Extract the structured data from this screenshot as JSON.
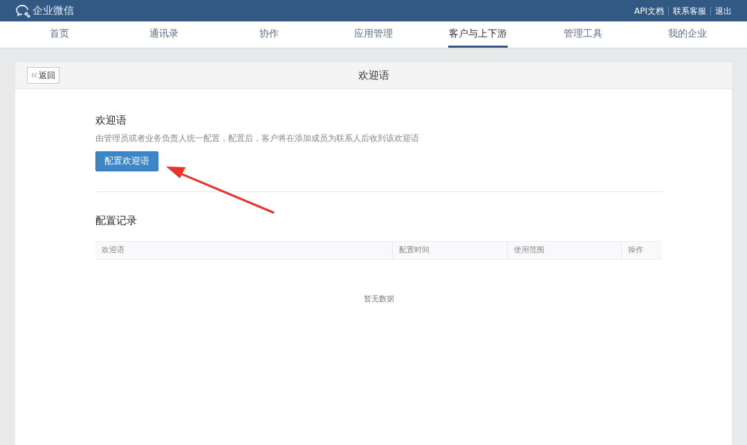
{
  "header": {
    "logo": "企业微信",
    "links": [
      "API文档",
      "联系客服",
      "退出"
    ]
  },
  "nav": [
    {
      "label": "首页",
      "selected": false
    },
    {
      "label": "通讯录",
      "selected": false
    },
    {
      "label": "协作",
      "selected": false
    },
    {
      "label": "应用管理",
      "selected": false
    },
    {
      "label": "客户与上下游",
      "selected": true
    },
    {
      "label": "管理工具",
      "selected": false
    },
    {
      "label": "我的企业",
      "selected": false
    }
  ],
  "page": {
    "back": "返回",
    "title": "欢迎语"
  },
  "section": {
    "title": "欢迎语",
    "description": "由管理员或者业务负责人统一配置，配置后，客户将在添加成员为联系人后收到该欢迎语",
    "button": "配置欢迎语"
  },
  "records": {
    "title": "配置记录",
    "columns": [
      "欢迎语",
      "配置时间",
      "使用范围",
      "操作"
    ],
    "empty": "暂无数据"
  }
}
